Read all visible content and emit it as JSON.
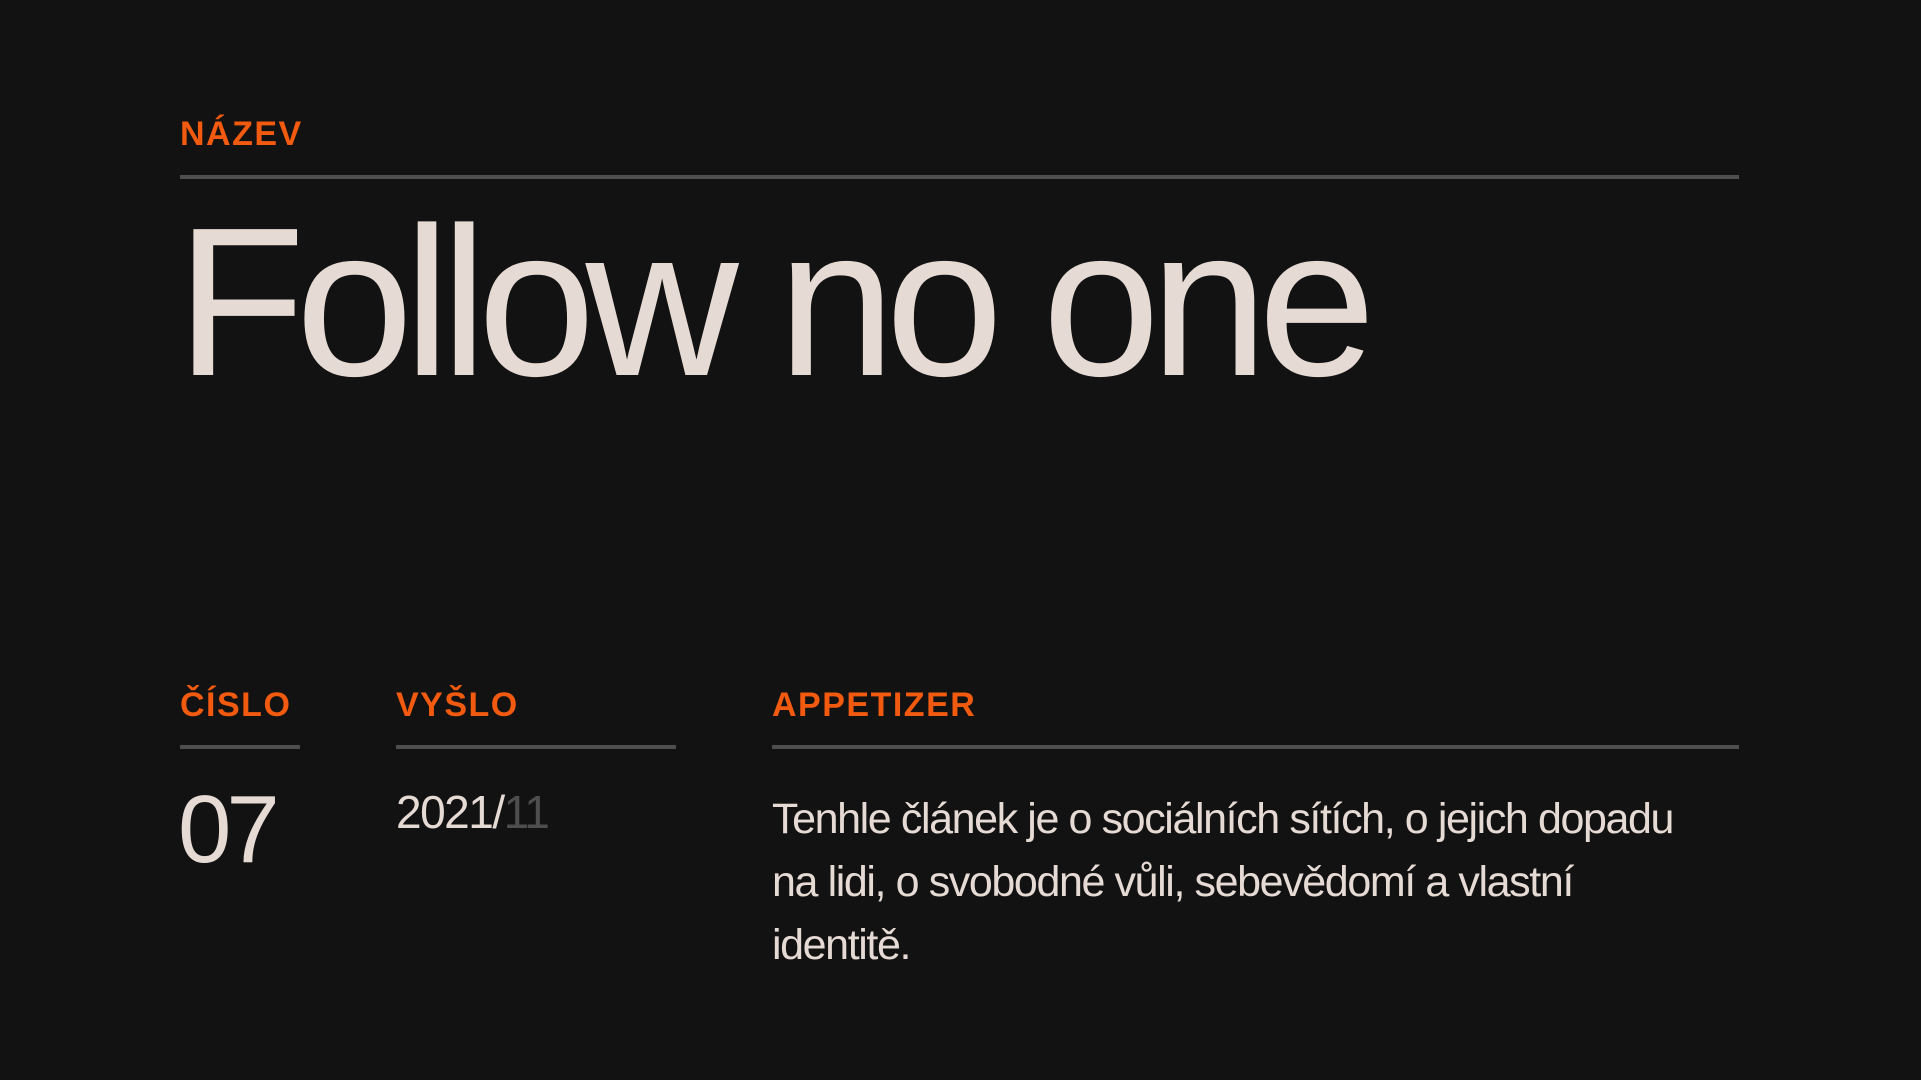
{
  "colors": {
    "background": "#121212",
    "accent": "#f25a0f",
    "text": "#e6dad4",
    "rule": "#4e4e4e",
    "muted": "#4e4e4e"
  },
  "title_section": {
    "label": "NÁZEV",
    "title": "Follow no one"
  },
  "issue": {
    "label": "ČÍSLO",
    "value": "07"
  },
  "published": {
    "label": "VYŠLO",
    "year": "2021/",
    "month": "11"
  },
  "appetizer": {
    "label": "APPETIZER",
    "text": "Tenhle článek je o sociálních sítích, o jejich dopadu na lidi, o svobodné vůli, sebevědomí a vlastní identitě."
  }
}
